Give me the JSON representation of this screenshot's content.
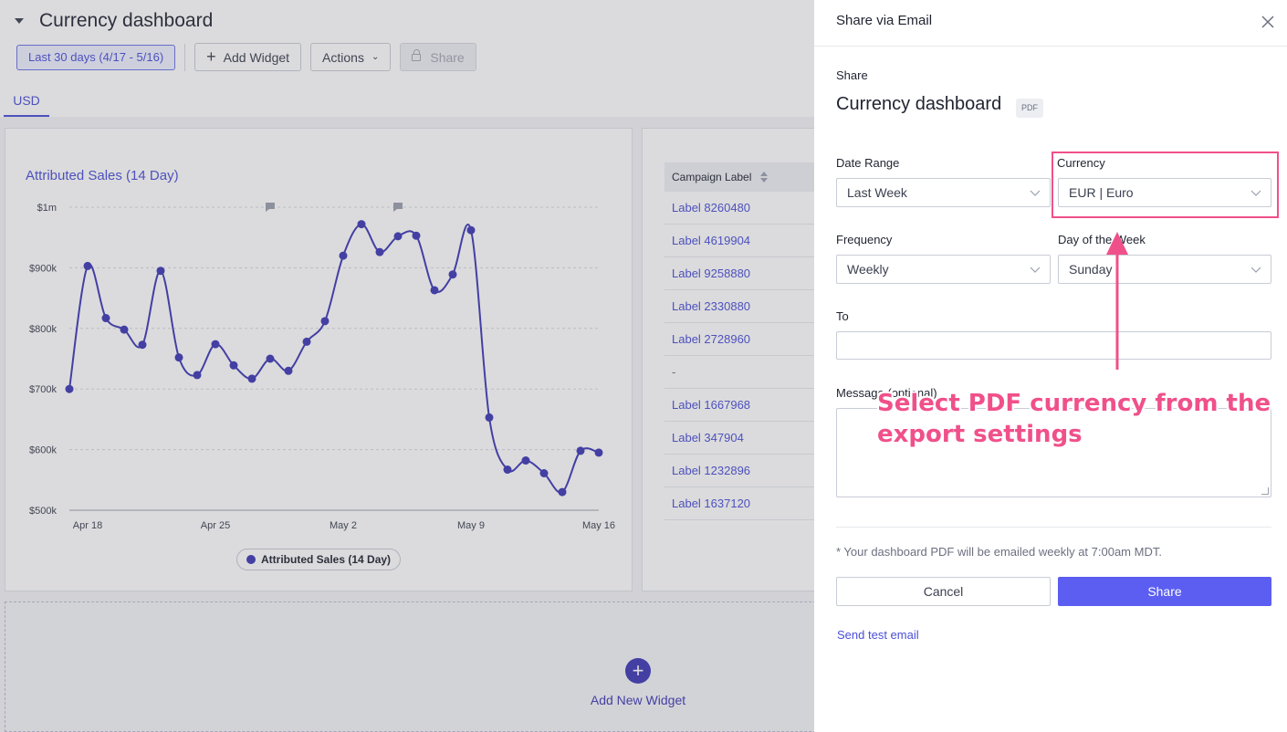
{
  "dashboard": {
    "title": "Currency dashboard",
    "toolbar": {
      "date_range": "Last 30 days (4/17 - 5/16)",
      "add_widget": "Add Widget",
      "actions": "Actions",
      "share": "Share"
    },
    "tab": "USD",
    "add_new_widget": "Add New Widget"
  },
  "chart_data": {
    "type": "line",
    "title": "Attributed Sales (14 Day)",
    "series": [
      {
        "name": "Attributed Sales (14 Day)",
        "color": "#3d38b5",
        "values": [
          700000,
          903000,
          817000,
          798000,
          773000,
          895000,
          752000,
          723000,
          774000,
          739000,
          717000,
          750000,
          730000,
          778000,
          812000,
          920000,
          972000,
          926000,
          952000,
          953000,
          863000,
          889000,
          962000,
          653000,
          567000,
          582000,
          561000,
          530000,
          598000,
          595000
        ]
      }
    ],
    "x_tick_labels": [
      "Apr 18",
      "Apr 25",
      "May 2",
      "May 9",
      "May 16"
    ],
    "y_tick_labels": [
      "$1m",
      "$900k",
      "$800k",
      "$700k",
      "$600k",
      "$500k"
    ],
    "ylim": [
      500000,
      1000000
    ],
    "grid": true,
    "legend": "bottom-center"
  },
  "table": {
    "header": "Campaign Label",
    "rows": [
      "Label 8260480",
      "Label 4619904",
      "Label 9258880",
      "Label 2330880",
      "Label 2728960",
      "-",
      "Label 1667968",
      "Label 347904",
      "Label 1232896",
      "Label 1637120"
    ]
  },
  "panel": {
    "title": "Share via Email",
    "share_label": "Share",
    "dashboard_name": "Currency dashboard",
    "format_badge": "PDF",
    "date_range_label": "Date Range",
    "date_range_value": "Last Week",
    "currency_label": "Currency",
    "currency_value": "EUR | Euro",
    "frequency_label": "Frequency",
    "frequency_value": "Weekly",
    "day_label": "Day of the Week",
    "day_value": "Sunday",
    "to_label": "To",
    "message_label": "Message (optional)",
    "note": "* Your dashboard PDF will be emailed weekly at 7:00am MDT.",
    "cancel": "Cancel",
    "share": "Share",
    "send_test": "Send test email"
  },
  "annotation": {
    "callout": "Select PDF currency from the export settings",
    "color": "#f0508a"
  }
}
